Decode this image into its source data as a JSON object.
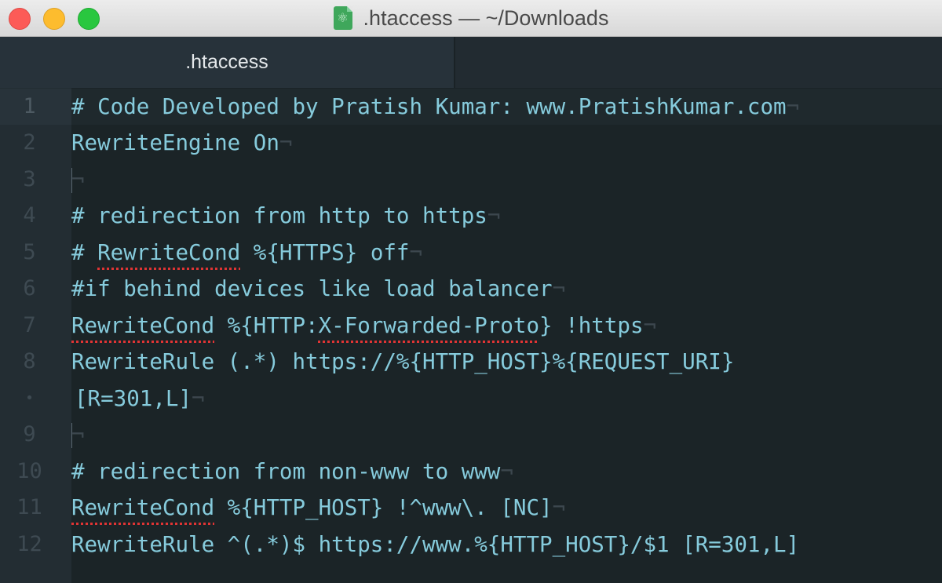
{
  "window": {
    "title": ".htaccess — ~/Downloads",
    "file_icon": "atom-file-icon",
    "traffic_lights": {
      "close": "#fc5b57",
      "minimize": "#fdbc2e",
      "maximize": "#29c73f"
    }
  },
  "tabs": [
    {
      "label": ".htaccess",
      "active": true
    }
  ],
  "editor": {
    "colors": {
      "text": "#86cbdc",
      "background": "#1b2427",
      "gutter": "#232d33",
      "spellcheck": "#e03434"
    },
    "eol_marker": "¬",
    "lines": [
      {
        "num": "1",
        "segments": [
          {
            "t": "# Code Developed by Pratish Kumar: www.PratishKumar.com"
          }
        ],
        "eol": true,
        "current": true
      },
      {
        "num": "2",
        "segments": [
          {
            "t": "RewriteEngine On"
          }
        ],
        "eol": true
      },
      {
        "num": "3",
        "segments": [],
        "eol": true,
        "empty": true
      },
      {
        "num": "4",
        "segments": [
          {
            "t": "# redirection from http to https"
          }
        ],
        "eol": true
      },
      {
        "num": "5",
        "segments": [
          {
            "t": "# "
          },
          {
            "t": "RewriteCond",
            "misspelled": true
          },
          {
            "t": " %{HTTPS} off"
          }
        ],
        "eol": true
      },
      {
        "num": "6",
        "segments": [
          {
            "t": "#if behind devices like load balancer"
          }
        ],
        "eol": true
      },
      {
        "num": "7",
        "segments": [
          {
            "t": "RewriteCond",
            "misspelled": true
          },
          {
            "t": " %{HTTP:"
          },
          {
            "t": "X-Forwarded-Proto",
            "misspelled": true
          },
          {
            "t": "} !https"
          }
        ],
        "eol": true
      },
      {
        "num": "8",
        "segments": [
          {
            "t": "RewriteRule (.*) https://%{HTTP_HOST}%{REQUEST_URI}"
          }
        ],
        "eol": false
      },
      {
        "num": "•",
        "segments": [
          {
            "t": "[R=301,L]"
          }
        ],
        "eol": true,
        "wrapped": true
      },
      {
        "num": "9",
        "segments": [],
        "eol": true,
        "empty": true
      },
      {
        "num": "10",
        "segments": [
          {
            "t": "# redirection from non-www to www"
          }
        ],
        "eol": true
      },
      {
        "num": "11",
        "segments": [
          {
            "t": "RewriteCond",
            "misspelled": true
          },
          {
            "t": " %{HTTP_HOST} !^www\\. [NC]"
          }
        ],
        "eol": true
      },
      {
        "num": "12",
        "segments": [
          {
            "t": "RewriteRule ^(.*)$ https://www.%{HTTP_HOST}/$1 [R=301,L]"
          }
        ],
        "eol": false
      }
    ]
  }
}
